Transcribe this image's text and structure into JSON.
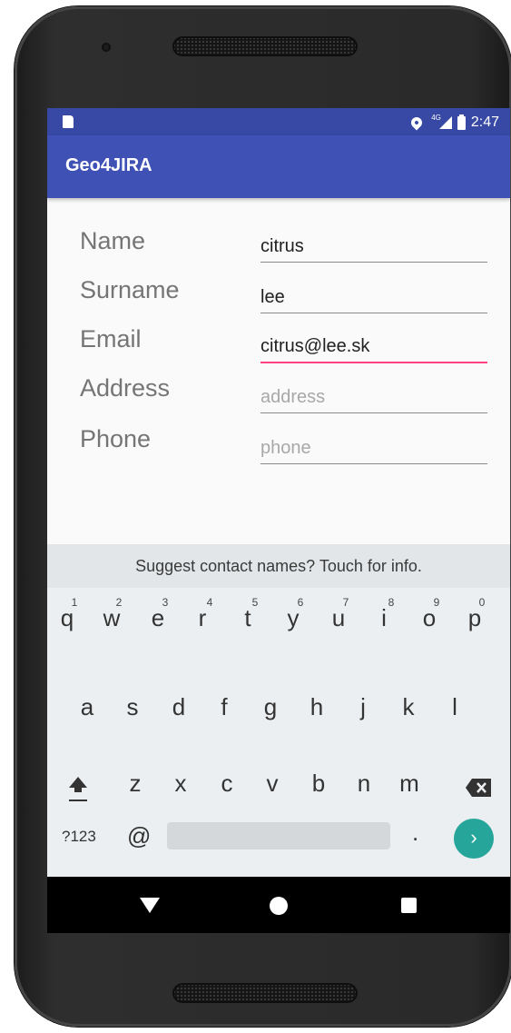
{
  "status_bar": {
    "time": "2:47",
    "network": "4G"
  },
  "app_bar": {
    "title": "Geo4JIRA"
  },
  "form": {
    "fields": [
      {
        "label": "Name",
        "value": "citrus",
        "placeholder": ""
      },
      {
        "label": "Surname",
        "value": "lee",
        "placeholder": ""
      },
      {
        "label": "Email",
        "value": "citrus@lee.sk",
        "placeholder": ""
      },
      {
        "label": "Address",
        "value": "",
        "placeholder": "address"
      },
      {
        "label": "Phone",
        "value": "",
        "placeholder": "phone"
      }
    ]
  },
  "keyboard": {
    "suggestion": "Suggest contact names? Touch for info.",
    "row1": [
      "q",
      "w",
      "e",
      "r",
      "t",
      "y",
      "u",
      "i",
      "o",
      "p"
    ],
    "row1_hints": [
      "1",
      "2",
      "3",
      "4",
      "5",
      "6",
      "7",
      "8",
      "9",
      "0"
    ],
    "row2": [
      "a",
      "s",
      "d",
      "f",
      "g",
      "h",
      "j",
      "k",
      "l"
    ],
    "row3": [
      "z",
      "x",
      "c",
      "v",
      "b",
      "n",
      "m"
    ],
    "symbols_label": "?123",
    "at_label": "@",
    "period_label": ".",
    "enter_icon": "chevron-right-icon"
  },
  "nav_bar": {
    "icons": [
      "back-icon",
      "home-icon",
      "recents-icon"
    ]
  },
  "colors": {
    "primary": "#3f51b5",
    "status_bar": "#3748a5",
    "accent": "#ff4081",
    "enter_key": "#26a69a"
  }
}
